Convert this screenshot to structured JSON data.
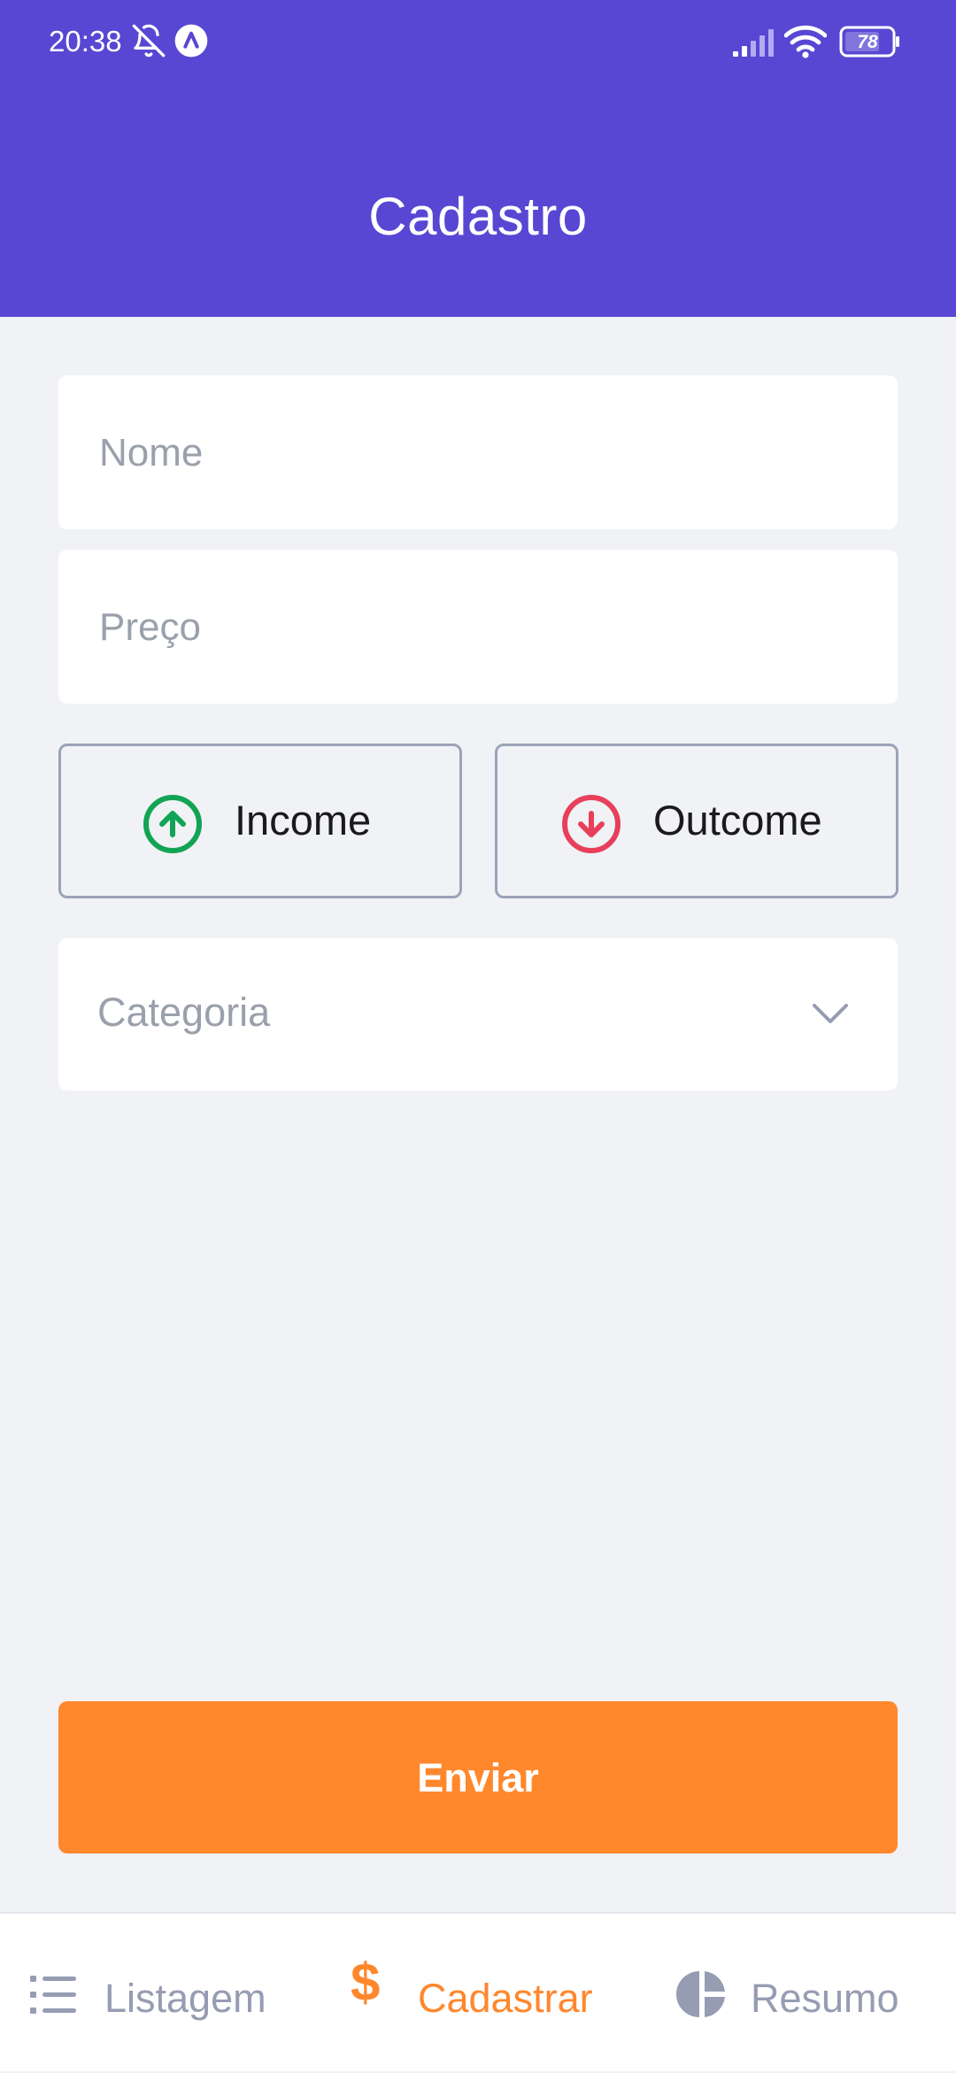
{
  "status_bar": {
    "time": "20:38",
    "battery": "78"
  },
  "header": {
    "title": "Cadastro"
  },
  "form": {
    "name": {
      "placeholder": "Nome",
      "value": ""
    },
    "price": {
      "placeholder": "Preço",
      "value": ""
    },
    "type_buttons": {
      "income_label": "Income",
      "income_icon": "arrow-up-circle-icon",
      "income_color": "#12a454",
      "outcome_label": "Outcome",
      "outcome_icon": "arrow-down-circle-icon",
      "outcome_color": "#e83f5b"
    },
    "category": {
      "placeholder": "Categoria"
    },
    "submit_label": "Enviar"
  },
  "bottom_nav": {
    "items": [
      {
        "label": "Listagem",
        "icon": "list-icon",
        "active": false
      },
      {
        "label": "Cadastrar",
        "icon": "dollar-sign-icon",
        "active": true
      },
      {
        "label": "Resumo",
        "icon": "pie-chart-icon",
        "active": false
      }
    ]
  },
  "colors": {
    "primary": "#5847d3",
    "accent": "#ff872c",
    "background": "#f0f2f5",
    "inactive_text": "#969cb2"
  }
}
